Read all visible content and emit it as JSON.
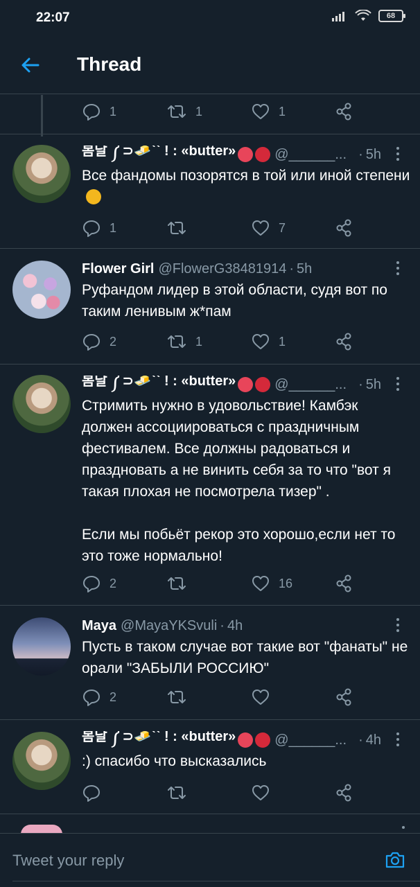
{
  "status_bar": {
    "time": "22:07",
    "battery": "68"
  },
  "header": {
    "title": "Thread"
  },
  "top_actions": {
    "replies": "1",
    "retweets": "1",
    "likes": "1"
  },
  "tweets": [
    {
      "name": "봄날 ༼⊃🧈`` ! : «butter»",
      "handle": "@______...",
      "time": "5h",
      "text": "Все фандомы позорятся в той или иной степени",
      "replies": "1",
      "retweets": "",
      "likes": "7"
    },
    {
      "name": "Flower Girl",
      "handle": "@FlowerG38481914",
      "time": "5h",
      "text": "Руфандом лидер в этой области, судя вот по таким ленивым ж*пам",
      "replies": "2",
      "retweets": "1",
      "likes": "1"
    },
    {
      "name": "봄날 ༼⊃🧈`` ! : «butter»",
      "handle": "@______...",
      "time": "5h",
      "text": "Стримить нужно в удовольствие! Камбэк должен ассоциироваться с праздничным фестивалем. Все должны радоваться и праздновать а не винить себя за то что \"вот я такая плохая не посмотрела тизер\" .\n\nЕсли мы побьёт рекор это хорошо,если нет то это тоже нормально!",
      "replies": "2",
      "retweets": "",
      "likes": "16"
    },
    {
      "name": "Maya",
      "handle": "@MayaYKSvuli",
      "time": "4h",
      "text": "Пусть в таком случае вот такие вот \"фанаты\" не орали \"ЗАБЫЛИ РОССИЮ\"",
      "replies": "2",
      "retweets": "",
      "likes": ""
    },
    {
      "name": "봄날 ༼⊃🧈`` ! : «butter»",
      "handle": "@______...",
      "time": "4h",
      "text": ":) спасибо что высказались",
      "replies": "",
      "retweets": "",
      "likes": ""
    }
  ],
  "reply_bar": {
    "placeholder": "Tweet your reply"
  },
  "colors": {
    "background": "#15202b",
    "accent": "#1da1f2",
    "muted": "#8899a6",
    "divider": "#38444d"
  },
  "icons": [
    "back-arrow-icon",
    "reply-icon",
    "retweet-icon",
    "like-icon",
    "share-icon",
    "more-icon",
    "camera-icon",
    "wifi-icon",
    "signal-icon"
  ]
}
